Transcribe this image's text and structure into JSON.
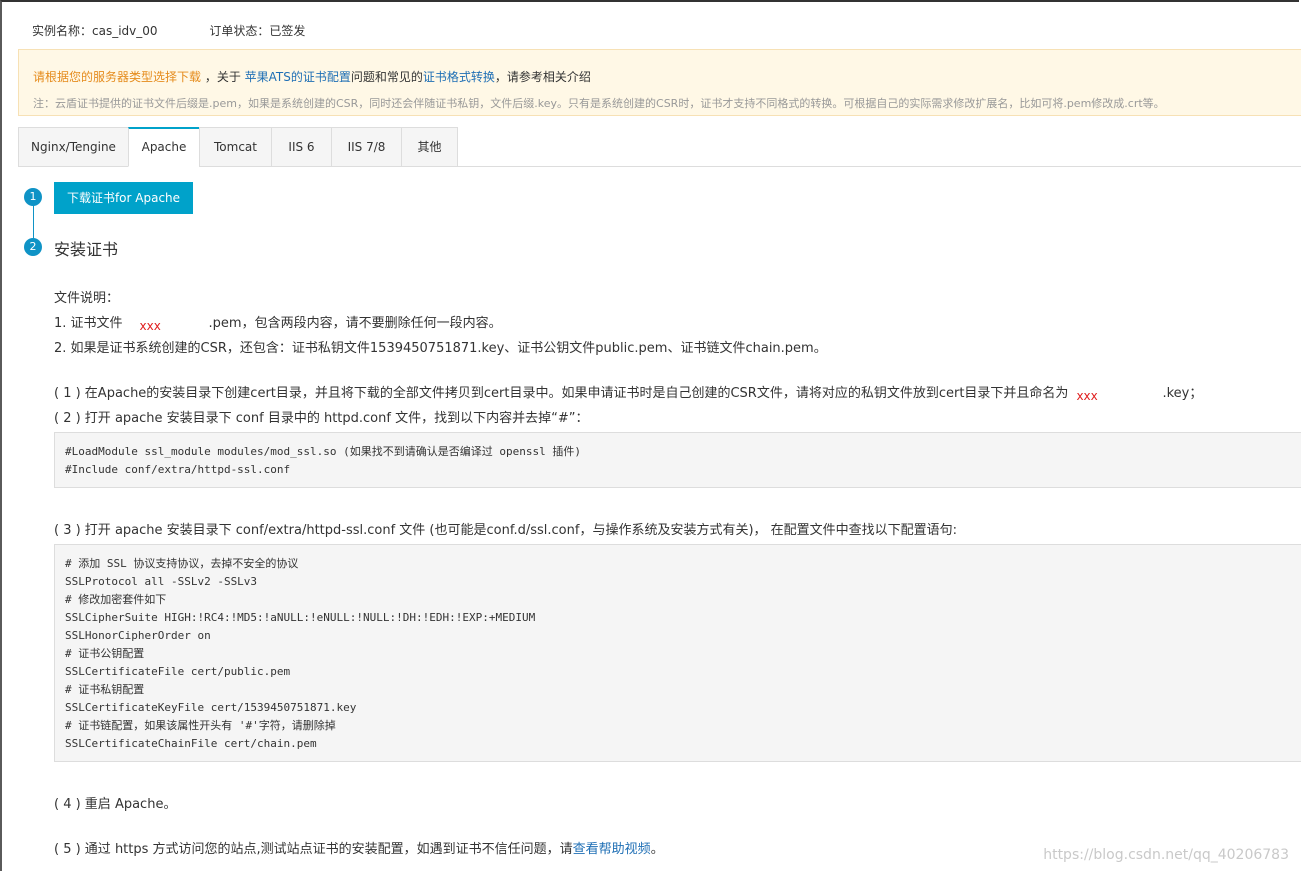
{
  "header": {
    "instance_label": "实例名称：cas_idv_00",
    "order_status_label": "订单状态：已签发"
  },
  "notice": {
    "select_download": "请根据您的服务器类型选择下载",
    "about": " ，关于 ",
    "ats_link": "苹果ATS的证书配置",
    "mid": "问题和常见的",
    "format_link": "证书格式转换",
    "tail": "，请参考相关介绍",
    "note": "注：云盾证书提供的证书文件后缀是.pem，如果是系统创建的CSR，同时还会伴随证书私钥，文件后缀.key。只有是系统创建的CSR时，证书才支持不同格式的转换。可根据自己的实际需求修改扩展名，比如可将.pem修改成.crt等。"
  },
  "tabs": [
    {
      "label": "Nginx/Tengine"
    },
    {
      "label": "Apache"
    },
    {
      "label": "Tomcat"
    },
    {
      "label": "IIS 6"
    },
    {
      "label": "IIS 7/8"
    },
    {
      "label": "其他"
    }
  ],
  "steps": {
    "step1_number": "1",
    "download_label": "下载证书for Apache",
    "step2_number": "2",
    "step2_title": "安装证书"
  },
  "files": {
    "heading": "文件说明：",
    "line1_prefix": "1. 证书文件",
    "line1_redacted": "xxx",
    "line1_suffix": ".pem，包含两段内容，请不要删除任何一段内容。",
    "line2": "2. 如果是证书系统创建的CSR，还包含：证书私钥文件1539450751871.key、证书公钥文件public.pem、证书链文件chain.pem。"
  },
  "instructions": {
    "step1_prefix": "( 1 ) 在Apache的安装目录下创建cert目录，并且将下载的全部文件拷贝到cert目录中。如果申请证书时是自己创建的CSR文件，请将对应的私钥文件放到cert目录下并且命名为",
    "step1_redacted": "xxx",
    "step1_suffix": ".key；",
    "step2": "( 2 ) 打开 apache 安装目录下 conf 目录中的 httpd.conf 文件，找到以下内容并去掉“#”：",
    "step3": "( 3 ) 打开 apache 安装目录下 conf/extra/httpd-ssl.conf 文件 (也可能是conf.d/ssl.conf，与操作系统及安装方式有关)， 在配置文件中查找以下配置语句:",
    "step4": "( 4 ) 重启 Apache。",
    "step5_prefix": "( 5 ) 通过 https 方式访问您的站点,测试站点证书的安装配置，如遇到证书不信任问题，请",
    "step5_link": "查看帮助视频",
    "step5_suffix": "。"
  },
  "code_block_1": [
    "#LoadModule ssl_module modules/mod_ssl.so (如果找不到请确认是否编译过 openssl 插件)",
    "#Include conf/extra/httpd-ssl.conf"
  ],
  "code_block_2": [
    "# 添加 SSL 协议支持协议，去掉不安全的协议",
    "SSLProtocol all -SSLv2 -SSLv3",
    "# 修改加密套件如下",
    "SSLCipherSuite HIGH:!RC4:!MD5:!aNULL:!eNULL:!NULL:!DH:!EDH:!EXP:+MEDIUM",
    "SSLHonorCipherOrder on",
    "# 证书公钥配置",
    "SSLCertificateFile cert/public.pem",
    "# 证书私钥配置",
    "SSLCertificateKeyFile cert/1539450751871.key",
    "# 证书链配置，如果该属性开头有 '#'字符，请删除掉",
    "SSLCertificateChainFile cert/chain.pem"
  ],
  "watermark": "https://blog.csdn.net/qq_40206783",
  "colors": {
    "accent": "#00a2ca",
    "link": "#1f6fb5",
    "warning": "#e58b1c",
    "redacted": "#e02020"
  }
}
